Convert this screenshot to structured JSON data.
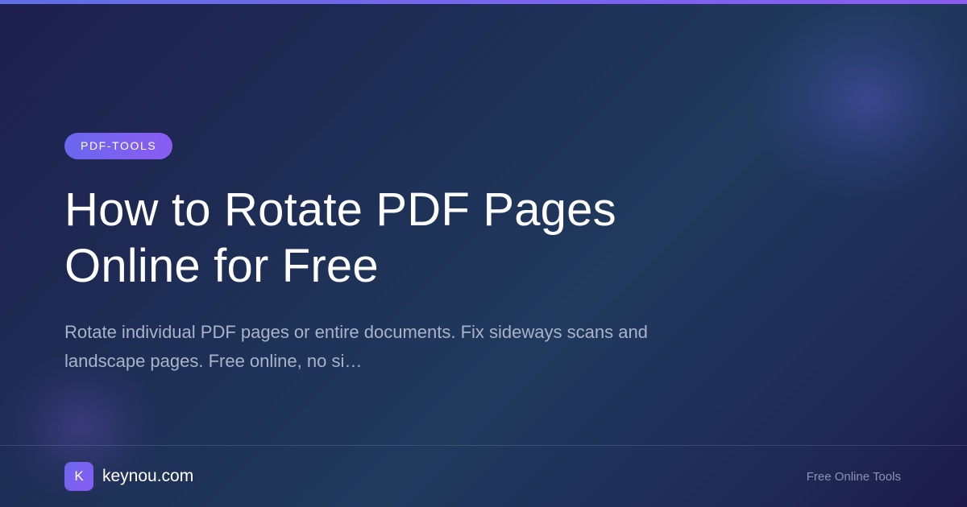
{
  "tag": "PDF-TOOLS",
  "title_line1": "How to Rotate PDF Pages",
  "title_line2": "Online for Free",
  "description_line1": "Rotate individual PDF pages or entire documents. Fix sideways scans and",
  "description_line2": "landscape pages. Free online, no si…",
  "brand": {
    "logo_letter": "K",
    "name": "keynou.com"
  },
  "footer_tagline": "Free Online Tools",
  "colors": {
    "accent": "#7b63f0",
    "background": "#1f3358",
    "description_text": "#a9b3c9"
  }
}
